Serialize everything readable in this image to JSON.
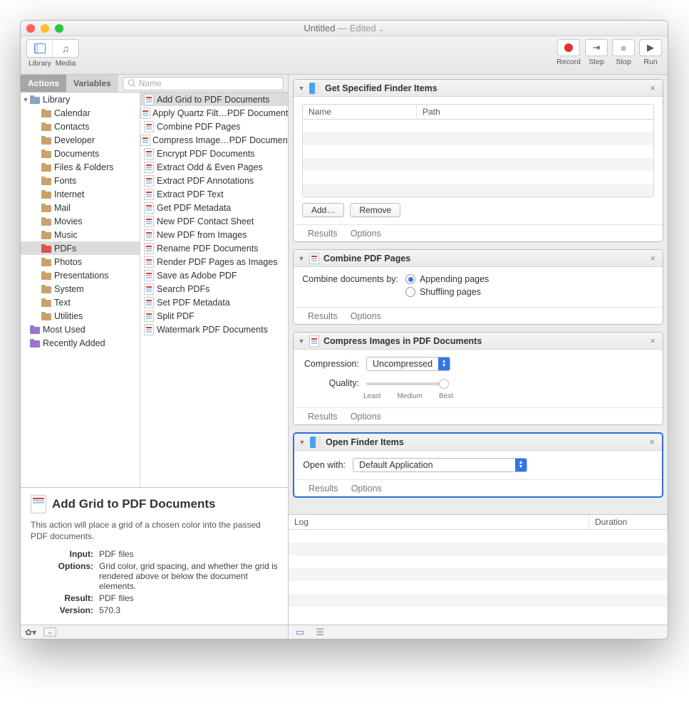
{
  "window": {
    "title": "Untitled",
    "subtitle": "— Edited"
  },
  "toolbar": {
    "left": [
      {
        "key": "library",
        "label": "Library"
      },
      {
        "key": "media",
        "label": "Media"
      }
    ],
    "right": [
      {
        "key": "record",
        "label": "Record"
      },
      {
        "key": "step",
        "label": "Step"
      },
      {
        "key": "stop",
        "label": "Stop"
      },
      {
        "key": "run",
        "label": "Run"
      }
    ]
  },
  "tabs": {
    "active": "Actions",
    "other": "Variables"
  },
  "search": {
    "placeholder": "Name"
  },
  "library": {
    "root": "Library",
    "categories": [
      "Calendar",
      "Contacts",
      "Developer",
      "Documents",
      "Files & Folders",
      "Fonts",
      "Internet",
      "Mail",
      "Movies",
      "Music",
      "PDFs",
      "Photos",
      "Presentations",
      "System",
      "Text",
      "Utilities"
    ],
    "selected_category": "PDFs",
    "smart": [
      "Most Used",
      "Recently Added"
    ]
  },
  "actions_list": {
    "selected": "Add Grid to PDF Documents",
    "items": [
      "Add Grid to PDF Documents",
      "Apply Quartz Filt…PDF Documents",
      "Combine PDF Pages",
      "Compress Image…PDF Documents",
      "Encrypt PDF Documents",
      "Extract Odd & Even Pages",
      "Extract PDF Annotations",
      "Extract PDF Text",
      "Get PDF Metadata",
      "New PDF Contact Sheet",
      "New PDF from Images",
      "Rename PDF Documents",
      "Render PDF Pages as Images",
      "Save as Adobe PDF",
      "Search PDFs",
      "Set PDF Metadata",
      "Split PDF",
      "Watermark PDF Documents"
    ]
  },
  "info": {
    "title": "Add Grid to PDF Documents",
    "desc": "This action will place a grid of a chosen color into the passed PDF documents.",
    "rows": [
      {
        "k": "Input:",
        "v": "PDF files"
      },
      {
        "k": "Options:",
        "v": "Grid color, grid spacing, and whether the grid is rendered above or below the document elements."
      },
      {
        "k": "Result:",
        "v": "PDF files"
      },
      {
        "k": "Version:",
        "v": "570.3"
      }
    ]
  },
  "workflow": [
    {
      "id": "get_finder",
      "title": "Get Specified Finder Items",
      "table_cols": [
        "Name",
        "Path"
      ],
      "buttons": [
        "Add…",
        "Remove"
      ],
      "footer": [
        "Results",
        "Options"
      ]
    },
    {
      "id": "combine",
      "title": "Combine PDF Pages",
      "label": "Combine documents by:",
      "options": [
        "Appending pages",
        "Shuffling pages"
      ],
      "selected_option": "Appending pages",
      "footer": [
        "Results",
        "Options"
      ]
    },
    {
      "id": "compress",
      "title": "Compress Images in PDF Documents",
      "compression_label": "Compression:",
      "compression_value": "Uncompressed",
      "quality_label": "Quality:",
      "ticks": [
        "Least",
        "Medium",
        "Best"
      ],
      "footer": [
        "Results",
        "Options"
      ]
    },
    {
      "id": "open_finder",
      "title": "Open Finder Items",
      "open_label": "Open with:",
      "open_value": "Default Application",
      "footer": [
        "Results",
        "Options"
      ],
      "selected": true
    }
  ],
  "log": {
    "cols": [
      "Log",
      "Duration"
    ]
  }
}
